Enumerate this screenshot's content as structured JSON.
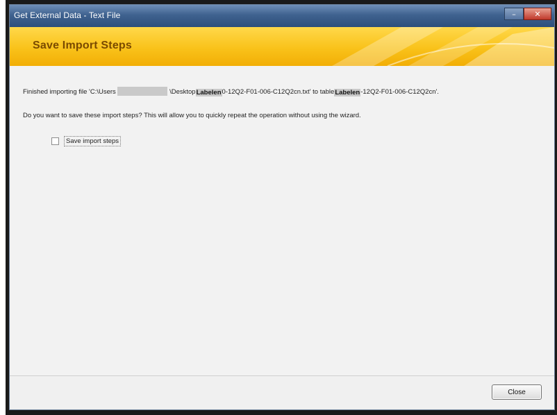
{
  "window": {
    "title": "Get External Data - Text File",
    "controls": {
      "minimize": "–",
      "maximize": "□",
      "close": "✕"
    }
  },
  "banner": {
    "title": "Save Import Steps"
  },
  "content": {
    "finished_prefix": "Finished importing file 'C:\\Users",
    "finished_path_mid": "\\Desktop",
    "finished_file_highlight": "Labelen",
    "finished_file_rest": "0-12Q2-F01-006-C12Q2cn.txt' to table",
    "finished_table_highlight": "Labelen",
    "finished_table_rest": "-12Q2-F01-006-C12Q2cn'.",
    "question": "Do you want to save these import steps? This will allow you to quickly repeat the operation without using the wizard.",
    "save_checkbox_label": "Save import steps",
    "save_checkbox_checked": false
  },
  "footer": {
    "close_label": "Close"
  },
  "colors": {
    "titlebar": "#3f628f",
    "banner": "#f9c21a",
    "banner_text": "#7a4a00"
  }
}
